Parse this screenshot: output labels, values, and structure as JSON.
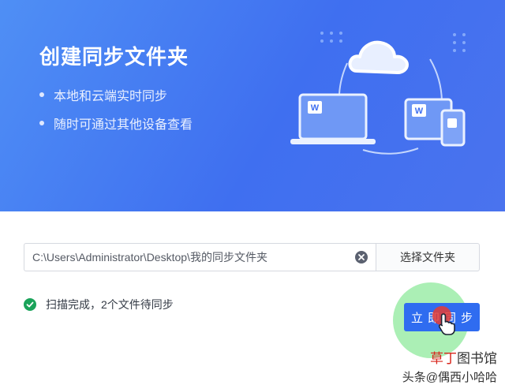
{
  "header": {
    "title": "创建同步文件夹",
    "features": [
      "本地和云端实时同步",
      "随时可通过其他设备查看"
    ]
  },
  "illustration": {
    "file_badge": "W"
  },
  "path_field": {
    "value": "C:\\Users\\Administrator\\Desktop\\我的同步文件夹"
  },
  "choose_folder_label": "选择文件夹",
  "status": {
    "text": "扫描完成，2个文件待同步"
  },
  "sync_button_label": "立即同步",
  "watermark": {
    "line1_red": "草丁",
    "line1_rest": "图书馆",
    "line2": "头条@偶西小哈哈"
  },
  "colors": {
    "accent": "#2f6cf0",
    "hero_start": "#4f8ff5",
    "hero_end": "#3f6ff0",
    "success": "#1aa35a"
  }
}
